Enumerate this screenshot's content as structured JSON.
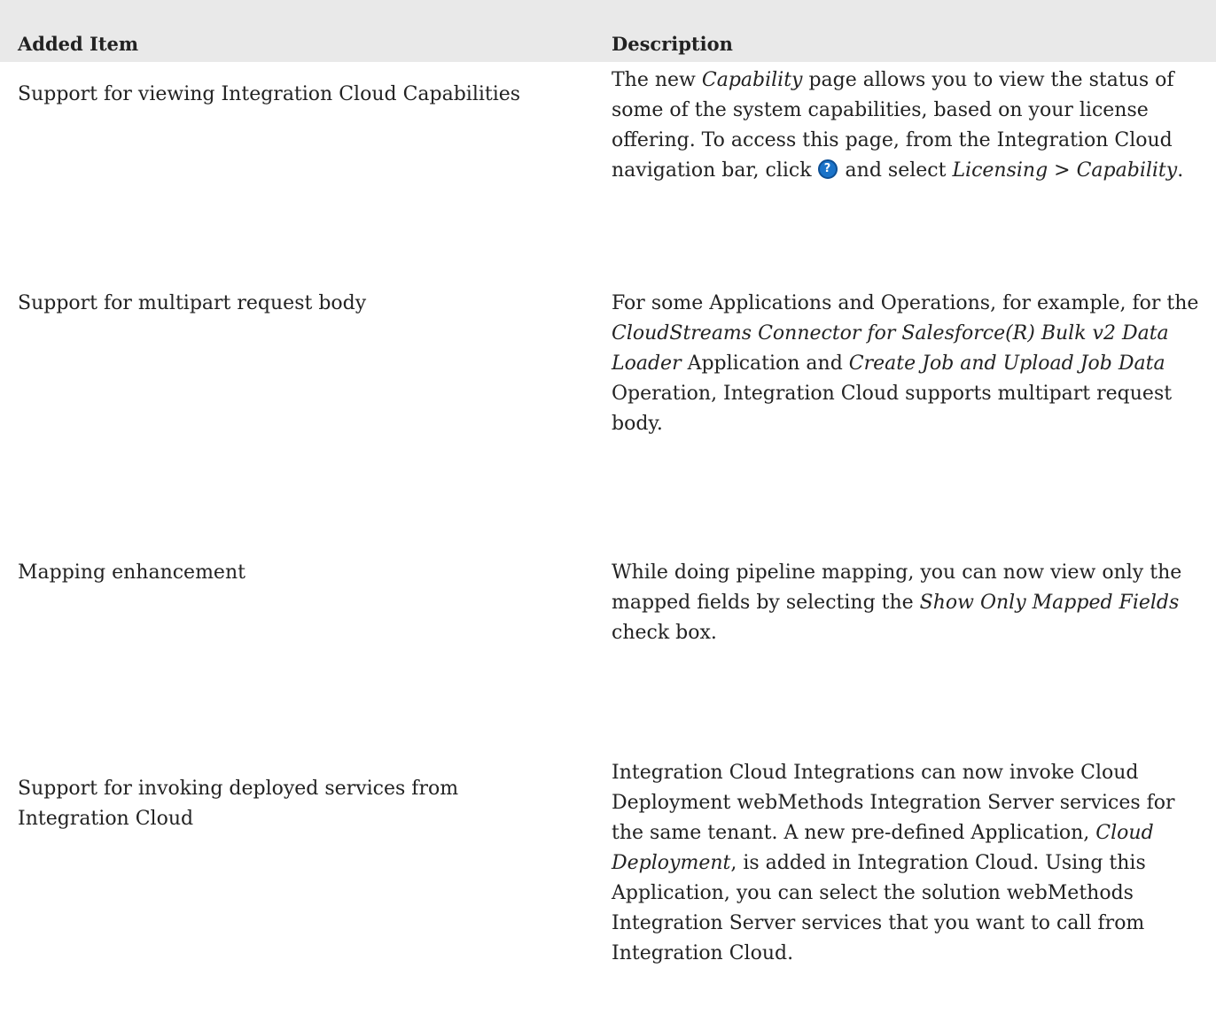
{
  "table": {
    "header": {
      "item": "Added Item",
      "description": "Description"
    },
    "rows": [
      {
        "item": "Support for viewing Integration Cloud Capabilities",
        "desc": {
          "p1": "The new ",
          "i1": "Capability",
          "p2": " page allows you to view the status of some of the system capabilities, based on your license offering. To access this page, from the Integration Cloud navigation bar, click ",
          "icon": "help-icon",
          "p3": " and select ",
          "i2": "Licensing",
          "p4": " > ",
          "i3": "Capability",
          "p5": "."
        }
      },
      {
        "item": "Support for multipart request body",
        "desc": {
          "p1": "For some Applications and Operations, for example, for the ",
          "i1": "CloudStreams Connector for Salesforce(R) Bulk v2 Data Loader",
          "p2": " Application and ",
          "i2": "Create Job and Upload Job Data",
          "p3": " Operation, Integration Cloud supports multipart request body."
        }
      },
      {
        "item": "Mapping enhancement",
        "desc": {
          "p1": "While doing pipeline mapping, you can now view only the mapped fields by selecting the ",
          "i1": "Show Only Mapped Fields",
          "p2": " check box."
        }
      },
      {
        "item": "Support for invoking deployed services from Integration Cloud",
        "desc": {
          "p1": "Integration Cloud Integrations can now invoke Cloud Deployment webMethods Integration Server services for the same tenant. A new pre-defined Application, ",
          "i1": "Cloud Deployment",
          "p2": ", is added in Integration Cloud. Using this Application, you can select the solution webMethods Integration Server services that you want to call from Integration Cloud."
        }
      }
    ]
  },
  "colors": {
    "header_bg": "#e9e9e9",
    "text": "#222222",
    "help_icon": "#1a73c9"
  }
}
